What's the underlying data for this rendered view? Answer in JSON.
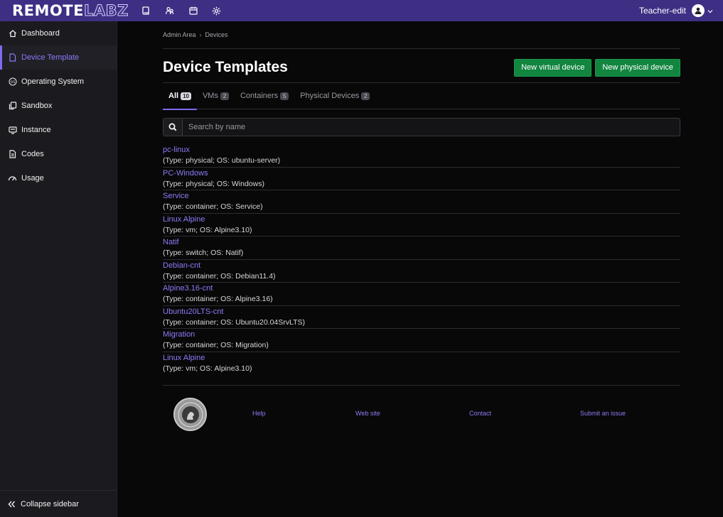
{
  "brand": {
    "part1": "REMOTE",
    "part2": "LABZ"
  },
  "topbar": {
    "icons": [
      "book-icon",
      "users-icon",
      "calendar-icon",
      "gear-icon"
    ],
    "user_label": "Teacher-edit"
  },
  "sidebar": {
    "items": [
      {
        "label": "Dashboard",
        "icon": "home-icon"
      },
      {
        "label": "Device Template",
        "icon": "file-icon",
        "active": true
      },
      {
        "label": "Operating System",
        "icon": "os-icon"
      },
      {
        "label": "Sandbox",
        "icon": "copy-icon"
      },
      {
        "label": "Instance",
        "icon": "monitor-icon"
      },
      {
        "label": "Codes",
        "icon": "document-icon"
      },
      {
        "label": "Usage",
        "icon": "gauge-icon"
      }
    ],
    "collapse_label": "Collapse sidebar"
  },
  "breadcrumb": {
    "root": "Admin Area",
    "sep": "›",
    "current": "Devices"
  },
  "page": {
    "title": "Device Templates",
    "btn_virtual": "New virtual device",
    "btn_physical": "New physical device"
  },
  "tabs": [
    {
      "label": "All",
      "count": "10"
    },
    {
      "label": "VMs",
      "count": "2"
    },
    {
      "label": "Containers",
      "count": "5"
    },
    {
      "label": "Physical Devices",
      "count": "2"
    }
  ],
  "search": {
    "placeholder": "Search by name"
  },
  "devices": [
    {
      "name": "pc-linux",
      "desc": "(Type: physical; OS: ubuntu-server)"
    },
    {
      "name": "PC-Windows",
      "desc": "(Type: physical; OS: Windows)"
    },
    {
      "name": "Service",
      "desc": "(Type: container; OS: Service)"
    },
    {
      "name": "Linux Alpine",
      "desc": "(Type: vm; OS: Alpine3.10)"
    },
    {
      "name": "Natif",
      "desc": "(Type: switch; OS: Natif)"
    },
    {
      "name": "Debian-cnt",
      "desc": "(Type: container; OS: Debian11.4)"
    },
    {
      "name": "Alpine3.16-cnt",
      "desc": "(Type: container; OS: Alpine3.16)"
    },
    {
      "name": "Ubuntu20LTS-cnt",
      "desc": "(Type: container; OS: Ubuntu20.04SrvLTS)"
    },
    {
      "name": "Migration",
      "desc": "(Type: container; OS: Migration)"
    },
    {
      "name": "Linux Alpine",
      "desc": "(Type: vm; OS: Alpine3.10)"
    }
  ],
  "footer": {
    "links": [
      "Help",
      "Web site",
      "Contact",
      "Submit an issue"
    ]
  },
  "colors": {
    "topbar": "#3e2f84",
    "accent": "#7b6cf0",
    "link": "#8b7cf6",
    "button": "#12853f"
  }
}
